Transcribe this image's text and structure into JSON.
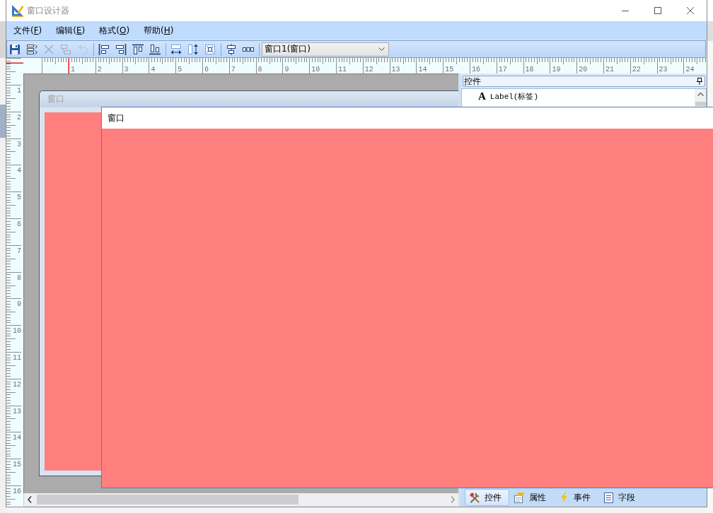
{
  "window": {
    "title": "窗口设计器"
  },
  "menu": [
    {
      "label": "文件(",
      "key": "F",
      "after": ")"
    },
    {
      "label": "编辑(",
      "key": "E",
      "after": ")"
    },
    {
      "label": "格式(",
      "key": "O",
      "after": ")"
    },
    {
      "label": "帮助(",
      "key": "H",
      "after": ")"
    }
  ],
  "toolbar": {
    "groups": [
      [
        {
          "kind": "save",
          "disabled": false
        },
        {
          "kind": "tab-order",
          "disabled": false
        },
        {
          "kind": "delete",
          "disabled": true
        },
        {
          "kind": "copy",
          "disabled": true
        },
        {
          "kind": "undo",
          "disabled": true
        }
      ],
      [
        {
          "kind": "align-left",
          "disabled": false
        },
        {
          "kind": "align-right",
          "disabled": false
        },
        {
          "kind": "align-top",
          "disabled": false
        },
        {
          "kind": "align-bottom",
          "disabled": false
        }
      ],
      [
        {
          "kind": "same-width",
          "disabled": false
        },
        {
          "kind": "same-height",
          "disabled": false
        },
        {
          "kind": "same-size",
          "disabled": false
        }
      ],
      [
        {
          "kind": "center",
          "disabled": false
        },
        {
          "kind": "distribute",
          "disabled": false
        }
      ]
    ],
    "object_selector": {
      "value": "窗口1(窗口)"
    }
  },
  "rulers": {
    "horizontal": [
      "1",
      "2",
      "3",
      "4",
      "5",
      "6",
      "7",
      "8",
      "9",
      "10",
      "11",
      "12",
      "13",
      "14",
      "15",
      "16",
      "17",
      "18",
      "19",
      "20",
      "21",
      "22",
      "23",
      "24"
    ],
    "vertical": [
      "1",
      "2",
      "3",
      "4",
      "5",
      "6",
      "7",
      "8",
      "9",
      "10",
      "11",
      "12",
      "13",
      "14",
      "15",
      "16"
    ]
  },
  "designer": {
    "form": {
      "title": "窗口"
    }
  },
  "toolbox": {
    "title": "控件",
    "items": [
      {
        "icon": "A",
        "label": "Label(标签)"
      }
    ]
  },
  "panel_tabs": [
    {
      "kind": "controls",
      "label": "控件",
      "selected": true
    },
    {
      "kind": "properties",
      "label": "属性",
      "selected": false
    },
    {
      "kind": "events",
      "label": "事件",
      "selected": false
    },
    {
      "kind": "fields",
      "label": "字段",
      "selected": false
    }
  ],
  "preview_window": {
    "title": "窗口"
  }
}
